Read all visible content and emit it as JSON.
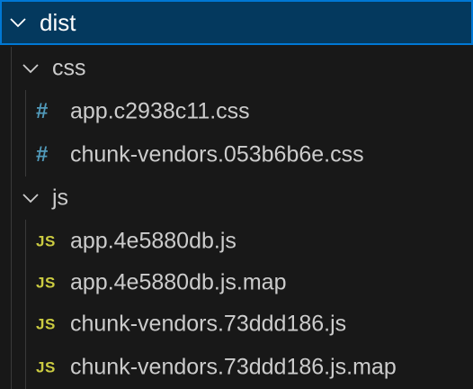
{
  "explorer": {
    "root": {
      "label": "dist",
      "icon": "chevron-down-icon"
    },
    "css_folder": {
      "label": "css",
      "icon": "chevron-down-icon",
      "files": [
        {
          "name": "app.c2938c11.css",
          "icon": "#"
        },
        {
          "name": "chunk-vendors.053b6b6e.css",
          "icon": "#"
        }
      ]
    },
    "js_folder": {
      "label": "js",
      "icon": "chevron-down-icon",
      "files": [
        {
          "name": "app.4e5880db.js",
          "icon": "JS"
        },
        {
          "name": "app.4e5880db.js.map",
          "icon": "JS"
        },
        {
          "name": "chunk-vendors.73ddd186.js",
          "icon": "JS"
        },
        {
          "name": "chunk-vendors.73ddd186.js.map",
          "icon": "JS"
        }
      ]
    }
  },
  "colors": {
    "background": "#181818",
    "selected_background": "#04395e",
    "selected_border": "#0078d4",
    "css_icon": "#519aba",
    "js_icon": "#cbcb41",
    "text": "#cccccc"
  }
}
